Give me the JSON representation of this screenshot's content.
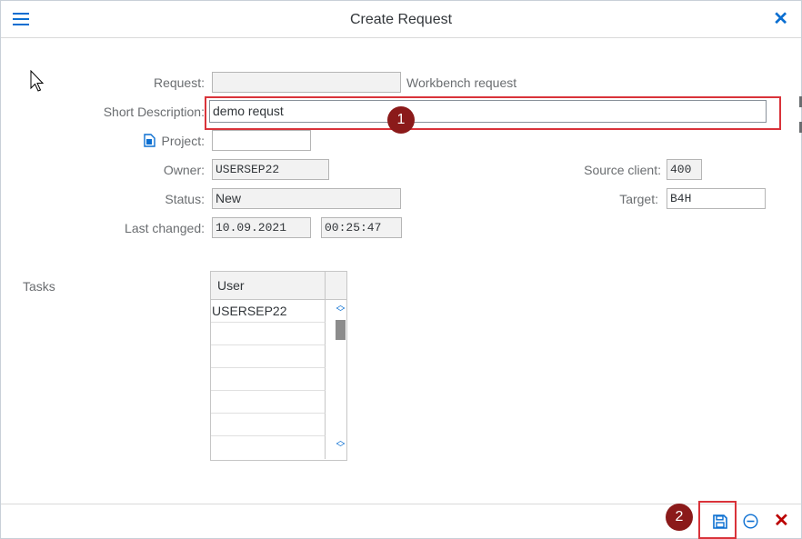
{
  "title": "Create Request",
  "form": {
    "request_label": "Request:",
    "request_value": "",
    "request_type": "Workbench request",
    "short_desc_label": "Short Description:",
    "short_desc_value": "demo requst",
    "project_label": "Project:",
    "project_value": "",
    "owner_label": "Owner:",
    "owner_value": "USERSEP22",
    "status_label": "Status:",
    "status_value": "New",
    "last_changed_label": "Last changed:",
    "last_changed_date": "10.09.2021",
    "last_changed_time": "00:25:47",
    "source_client_label": "Source client:",
    "source_client_value": "400",
    "target_label": "Target:",
    "target_value": "B4H"
  },
  "tasks": {
    "label": "Tasks",
    "column_header": "User",
    "rows": [
      "USERSEP22",
      "",
      "",
      "",
      "",
      "",
      ""
    ]
  },
  "annotations": {
    "step1": "1",
    "step2": "2"
  },
  "icons": {
    "menu": "hamburger-menu-icon",
    "close": "close-icon",
    "project": "project-document-icon",
    "save": "save-icon",
    "cancel": "cancel-circle-icon",
    "exit": "exit-icon"
  },
  "colors": {
    "accent": "#0a6ed1",
    "highlight": "#d9333a",
    "badge": "#8b1a1a",
    "exit": "#bb0000"
  }
}
